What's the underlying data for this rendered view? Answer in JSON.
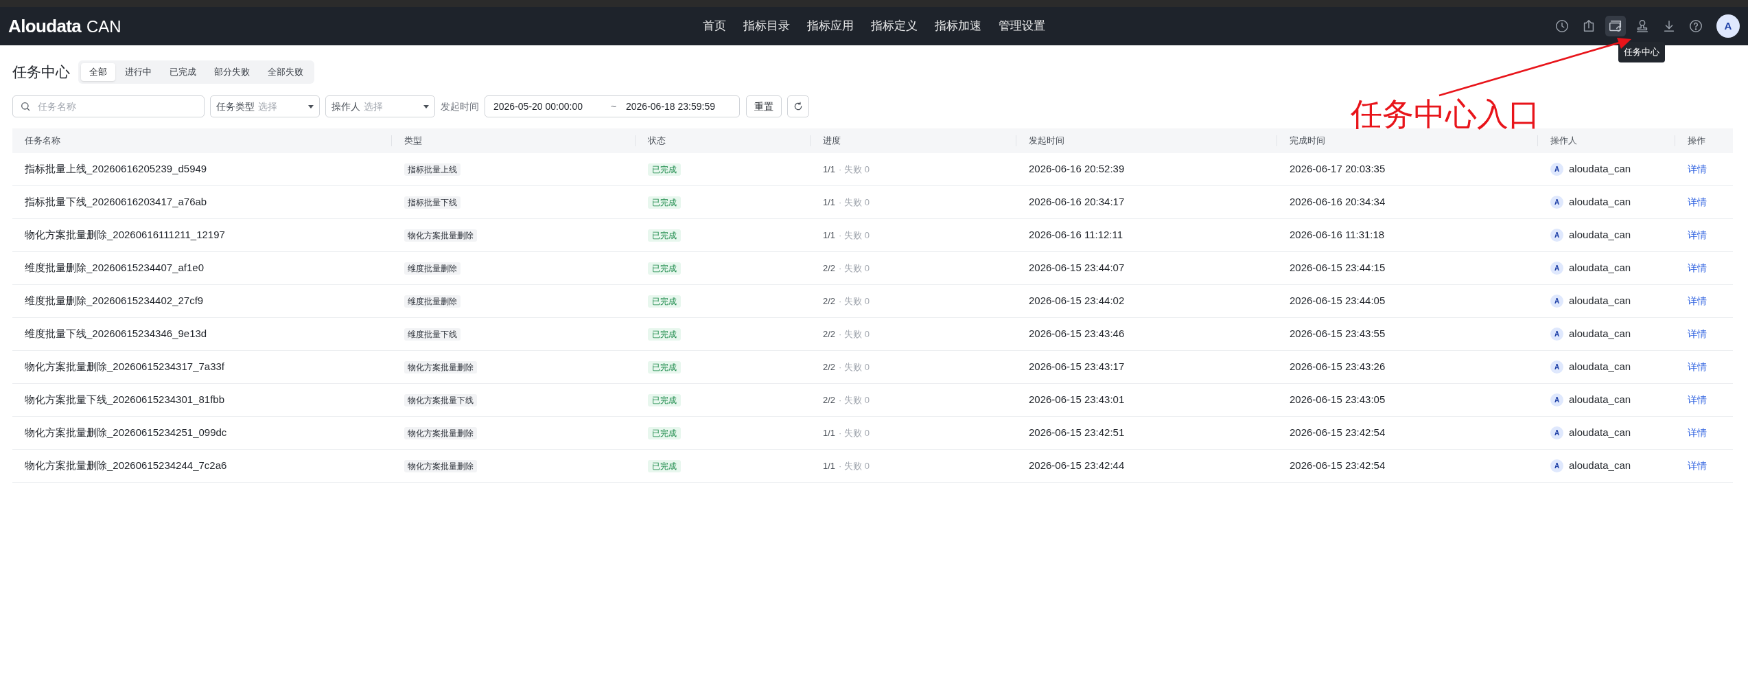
{
  "header": {
    "logo": "Aloudata",
    "logo_suffix": "CAN",
    "nav": [
      {
        "label": "首页"
      },
      {
        "label": "指标目录"
      },
      {
        "label": "指标应用"
      },
      {
        "label": "指标定义"
      },
      {
        "label": "指标加速"
      },
      {
        "label": "管理设置"
      }
    ],
    "toolbar_icons": [
      {
        "kind": "clock",
        "selected": false
      },
      {
        "kind": "share",
        "selected": false
      },
      {
        "kind": "tasks",
        "selected": true
      },
      {
        "kind": "stamp",
        "selected": false
      },
      {
        "kind": "download",
        "selected": false
      },
      {
        "kind": "help",
        "selected": false
      }
    ],
    "avatar": "A"
  },
  "tooltip": "任务中心",
  "annotation": "任务中心入口",
  "page": {
    "title": "任务中心",
    "tabs": [
      {
        "label": "全部",
        "selected": true
      },
      {
        "label": "进行中",
        "selected": false
      },
      {
        "label": "已完成",
        "selected": false
      },
      {
        "label": "部分失败",
        "selected": false
      },
      {
        "label": "全部失败",
        "selected": false
      }
    ]
  },
  "filters": {
    "name_placeholder": "任务名称",
    "type": {
      "label": "任务类型",
      "placeholder": "选择"
    },
    "operator": {
      "label": "操作人",
      "placeholder": "选择"
    },
    "time_label": "发起时间",
    "start": "2026-05-20 00:00:00",
    "separator": "~",
    "end": "2026-06-18 23:59:59",
    "reset": "重置"
  },
  "table": {
    "columns": [
      "任务名称",
      "类型",
      "状态",
      "进度",
      "发起时间",
      "完成时间",
      "操作人",
      "操作"
    ],
    "rows": [
      {
        "name": "指标批量上线_20260616205239_d5949",
        "type": "指标批量上线",
        "status": {
          "kind": "done",
          "label": "已完成"
        },
        "progress": "1/1",
        "failed": "· 失败 0",
        "start": "2026-06-16 20:52:39",
        "finish": "2026-06-17 20:03:35",
        "operator_avatar": "A",
        "operator": "aloudata_can",
        "action": "详情"
      },
      {
        "name": "指标批量下线_20260616203417_a76ab",
        "type": "指标批量下线",
        "status": {
          "kind": "done",
          "label": "已完成"
        },
        "progress": "1/1",
        "failed": "· 失败 0",
        "start": "2026-06-16 20:34:17",
        "finish": "2026-06-16 20:34:34",
        "operator_avatar": "A",
        "operator": "aloudata_can",
        "action": "详情"
      },
      {
        "name": "物化方案批量删除_20260616111211_12197",
        "type": "物化方案批量删除",
        "status": {
          "kind": "done",
          "label": "已完成"
        },
        "progress": "1/1",
        "failed": "· 失败 0",
        "start": "2026-06-16 11:12:11",
        "finish": "2026-06-16 11:31:18",
        "operator_avatar": "A",
        "operator": "aloudata_can",
        "action": "详情"
      },
      {
        "name": "维度批量删除_20260615234407_af1e0",
        "type": "维度批量删除",
        "status": {
          "kind": "done",
          "label": "已完成"
        },
        "progress": "2/2",
        "failed": "· 失败 0",
        "start": "2026-06-15 23:44:07",
        "finish": "2026-06-15 23:44:15",
        "operator_avatar": "A",
        "operator": "aloudata_can",
        "action": "详情"
      },
      {
        "name": "维度批量删除_20260615234402_27cf9",
        "type": "维度批量删除",
        "status": {
          "kind": "done",
          "label": "已完成"
        },
        "progress": "2/2",
        "failed": "· 失败 0",
        "start": "2026-06-15 23:44:02",
        "finish": "2026-06-15 23:44:05",
        "operator_avatar": "A",
        "operator": "aloudata_can",
        "action": "详情"
      },
      {
        "name": "维度批量下线_20260615234346_9e13d",
        "type": "维度批量下线",
        "status": {
          "kind": "done",
          "label": "已完成"
        },
        "progress": "2/2",
        "failed": "· 失败 0",
        "start": "2026-06-15 23:43:46",
        "finish": "2026-06-15 23:43:55",
        "operator_avatar": "A",
        "operator": "aloudata_can",
        "action": "详情"
      },
      {
        "name": "物化方案批量删除_20260615234317_7a33f",
        "type": "物化方案批量删除",
        "status": {
          "kind": "done",
          "label": "已完成"
        },
        "progress": "2/2",
        "failed": "· 失败 0",
        "start": "2026-06-15 23:43:17",
        "finish": "2026-06-15 23:43:26",
        "operator_avatar": "A",
        "operator": "aloudata_can",
        "action": "详情"
      },
      {
        "name": "物化方案批量下线_20260615234301_81fbb",
        "type": "物化方案批量下线",
        "status": {
          "kind": "done",
          "label": "已完成"
        },
        "progress": "2/2",
        "failed": "· 失败 0",
        "start": "2026-06-15 23:43:01",
        "finish": "2026-06-15 23:43:05",
        "operator_avatar": "A",
        "operator": "aloudata_can",
        "action": "详情"
      },
      {
        "name": "物化方案批量删除_20260615234251_099dc",
        "type": "物化方案批量删除",
        "status": {
          "kind": "done",
          "label": "已完成"
        },
        "progress": "1/1",
        "failed": "· 失败 0",
        "start": "2026-06-15 23:42:51",
        "finish": "2026-06-15 23:42:54",
        "operator_avatar": "A",
        "operator": "aloudata_can",
        "action": "详情"
      },
      {
        "name": "物化方案批量删除_20260615234244_7c2a6",
        "type": "物化方案批量删除",
        "status": {
          "kind": "done",
          "label": "已完成"
        },
        "progress": "1/1",
        "failed": "· 失败 0",
        "start": "2026-06-15 23:42:44",
        "finish": "2026-06-15 23:42:54",
        "operator_avatar": "A",
        "operator": "aloudata_can",
        "action": "详情"
      }
    ]
  }
}
